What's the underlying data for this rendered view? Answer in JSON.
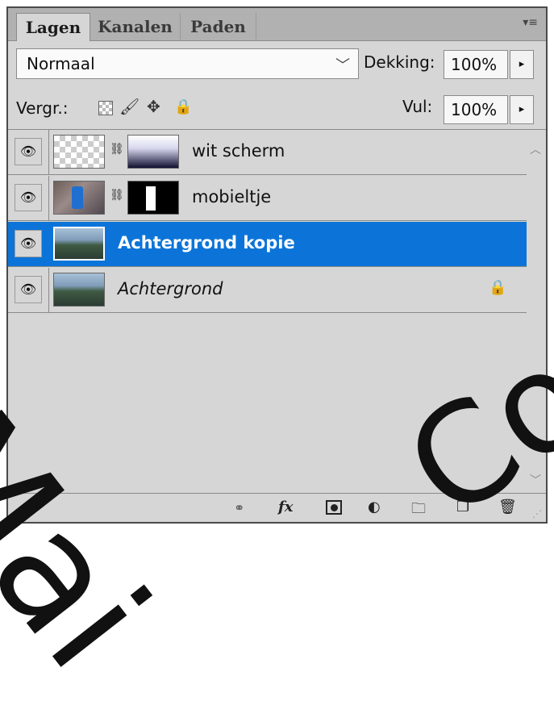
{
  "tabs": [
    {
      "label": "Lagen",
      "active": true
    },
    {
      "label": "Kanalen",
      "active": false
    },
    {
      "label": "Paden",
      "active": false
    }
  ],
  "panel_menu_icon": "panel-menu-icon",
  "blend": {
    "mode": "Normaal",
    "opacity_label": "Dekking:",
    "opacity_value": "100%"
  },
  "lock": {
    "label": "Vergr.:",
    "fill_label": "Vul:",
    "fill_value": "100%"
  },
  "layers": [
    {
      "name": "wit scherm",
      "visible": true,
      "selected": false,
      "has_mask": true
    },
    {
      "name": "mobieltje",
      "visible": true,
      "selected": false,
      "has_mask": true
    },
    {
      "name": "Achtergrond kopie",
      "visible": true,
      "selected": true,
      "has_mask": false
    },
    {
      "name": "Achtergrond",
      "visible": true,
      "selected": false,
      "has_mask": false,
      "locked": true
    }
  ],
  "bottom_tools": [
    "link-layers-icon",
    "fx-icon",
    "add-mask-icon",
    "adjustment-layer-icon",
    "new-group-icon",
    "new-layer-icon",
    "trash-icon"
  ],
  "fx_label": "fx",
  "watermark": {
    "line1": "Mai",
    "line2": "Co"
  },
  "colors": {
    "selection": "#0c74d8",
    "panel_bg": "#d6d6d6",
    "tab_bar": "#b1b1b1"
  }
}
